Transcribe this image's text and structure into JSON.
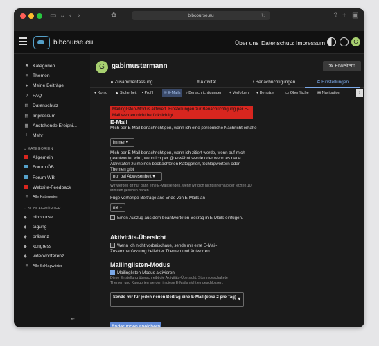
{
  "browser": {
    "url": "bibcourse.eu"
  },
  "header": {
    "site_name": "bibcourse.eu",
    "nav": [
      "Über uns",
      "Datenschutz",
      "Impressum"
    ],
    "avatar_letter": "G"
  },
  "sidebar": {
    "items": [
      {
        "label": "Kategorien",
        "icon": "tags-icon"
      },
      {
        "label": "Themen",
        "icon": "list-icon"
      },
      {
        "label": "Meine Beiträge",
        "icon": "user-icon"
      },
      {
        "label": "FAQ",
        "icon": "faq-icon"
      },
      {
        "label": "Datenschutz",
        "icon": "document-icon"
      },
      {
        "label": "Impressum",
        "icon": "document-icon"
      },
      {
        "label": "Anstehende Ereigni...",
        "icon": "calendar-icon"
      },
      {
        "label": "Mehr",
        "icon": "more-icon"
      }
    ],
    "categories_heading": "KATEGORIEN",
    "categories": [
      {
        "label": "Allgemein",
        "color": "#d8261f"
      },
      {
        "label": "Forum ÖB",
        "color": "#55a0c8"
      },
      {
        "label": "Forum WB",
        "color": "#55a0c8"
      },
      {
        "label": "Website-Feedback",
        "color": "#d8261f"
      },
      {
        "label": "Alle Kategorien"
      }
    ],
    "tags_heading": "SCHLAGWÖRTER",
    "tags": [
      "bibcourse",
      "tagung",
      "präsenz",
      "kongress",
      "videokonferenz",
      "Alle Schlagwörter"
    ]
  },
  "profile": {
    "avatar_letter": "G",
    "avatar_color": "#a8d070",
    "username": "gabimustermann",
    "expand_label": "Erweitern"
  },
  "main_tabs": [
    {
      "label": "Zusammenfassung",
      "icon": "user-icon"
    },
    {
      "label": "Aktivität",
      "icon": "list-icon"
    },
    {
      "label": "Benachrichtigungen",
      "icon": "bell-icon"
    },
    {
      "label": "Einstellungen",
      "icon": "gear-icon",
      "active": true
    }
  ],
  "sub_tabs": [
    {
      "label": "Konto"
    },
    {
      "label": "Sicherheit"
    },
    {
      "label": "Profil"
    },
    {
      "label": "E-Mails",
      "active": true
    },
    {
      "label": "Benachrichtigungen"
    },
    {
      "label": "Verfolgen"
    },
    {
      "label": "Benutzer"
    },
    {
      "label": "Oberfläche"
    },
    {
      "label": "Navigation"
    }
  ],
  "alert": {
    "text": "Mailinglisten-Modus aktiviert. Einstellungen zur Benachrichtigung per E-Mail werden nicht berücksichtigt.",
    "color": "#d8261f"
  },
  "email": {
    "heading": "E-Mail",
    "pm_label": "Mich per E-Mail benachrichtigen, wenn ich eine persönliche Nachricht erhalte",
    "pm_value": "immer",
    "mention_label": "Mich per E-Mail benachrichtigen, wenn ich zitiert werde, wenn auf mich geantwortet wird, wenn ich per @ erwähnt werde oder wenn es neue Aktivitäten zu meinen beobachteten Kategorien, Schlagwörtern oder Themen gibt",
    "mention_value": "nur bei Abwesenheit",
    "mention_hint": "Wir werden dir nur dann eine E-Mail senden, wenn wir dich nicht innerhalb der letzten 10 Minuten gesehen haben.",
    "previous_label": "Füge vorherige Beiträge ans Ende von E-Mails an",
    "previous_value": "nie",
    "excerpt_label": "Einen Auszug aus dem beantworteten Beitrag in E-Mails einfügen.",
    "excerpt_checked": false
  },
  "activity": {
    "heading": "Aktivitäts-Übersicht",
    "digest_label": "Wenn ich nicht vorbeischaue, sende mir eine E-Mail-Zusammenfassung beliebter Themen und Antworten",
    "digest_checked": false
  },
  "mailing": {
    "heading": "Mailinglisten-Modus",
    "enable_label": "Mailinglisten-Modus aktivieren",
    "enable_checked": true,
    "hint": "Diese Einstellung überschreibt die Aktivitäts-Übersicht. Stummgeschaltete Themen und Kategorien werden in diese E-Mails nicht eingeschlossen.",
    "frequency_value": "Sende mir für jeden neuen Beitrag eine E-Mail (etwa 2 pro Tag)"
  },
  "save_label": "Änderungen speichern"
}
